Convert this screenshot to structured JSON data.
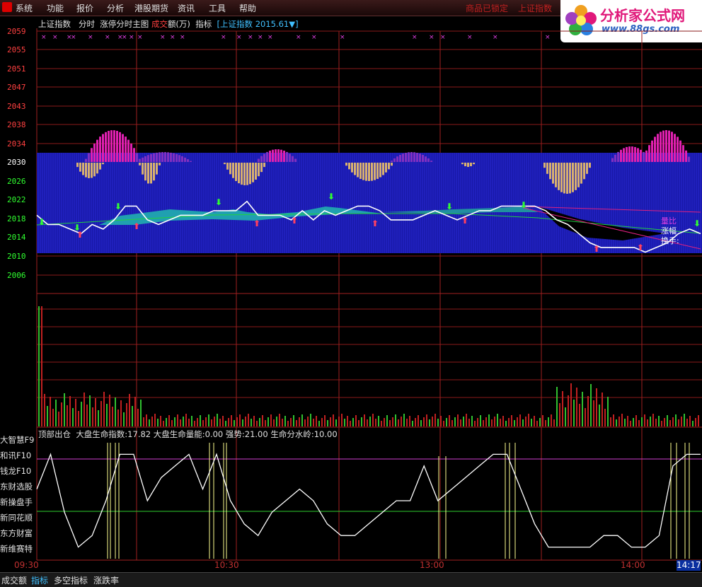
{
  "menu": {
    "items": [
      "系统",
      "功能",
      "报价",
      "分析",
      "港股期货",
      "资讯",
      "工具",
      "帮助"
    ],
    "right_items": [
      "商品已锁定",
      "上证指数"
    ]
  },
  "brand": {
    "title": "分析家公式网",
    "url": "www.88gs.com"
  },
  "header": {
    "name": "上证指数",
    "mode": "分时",
    "chart_name": "涨停分时主图",
    "volume_label_a": "成交",
    "volume_label_b": "额(万)",
    "indicator_label": "指标",
    "index_tag": "[上证指数 2015.61▼]"
  },
  "price_axis": {
    "labels": [
      "2059",
      "2055",
      "2051",
      "2047",
      "2043",
      "2038",
      "2034",
      "2030",
      "2026",
      "2022",
      "2018",
      "2014",
      "2010",
      "2006"
    ],
    "colors": {
      "up": "#ff4040",
      "flat": "#ffffff",
      "down": "#30ff30"
    }
  },
  "legend_right": {
    "a": "量比",
    "b": "涨幅",
    "c": "换手:"
  },
  "indicator": {
    "name": "顶部出仓",
    "values": "大盘生命指数:17.82  大盘生命量能:0.00  强势:21.00  生命分水岭:10.00"
  },
  "side_buttons": [
    "大智慧F9",
    "和讯F10",
    "钱龙F10",
    "东财选股",
    "新操盘手",
    "新同花顺",
    "东方财富",
    "新维赛特"
  ],
  "time_axis": {
    "labels": [
      "09:30",
      "10:30",
      "13:00",
      "14:00"
    ],
    "current": "14:17"
  },
  "tabs": [
    {
      "label": "成交额",
      "active": false
    },
    {
      "label": "指标",
      "active": true
    },
    {
      "label": "多空指标",
      "active": false
    },
    {
      "label": "涨跌率",
      "active": false
    }
  ],
  "chart_data": {
    "type": "line",
    "price_ylim": [
      2006,
      2059
    ],
    "price_x": [
      0,
      4,
      8,
      12,
      16,
      20,
      24,
      28,
      32,
      36,
      40,
      44,
      48,
      52,
      56,
      60,
      64,
      68,
      72,
      76,
      80,
      84,
      88,
      92,
      96,
      100,
      104,
      108,
      112,
      116,
      120,
      124,
      128,
      132,
      136,
      140,
      144,
      148,
      152,
      156,
      160,
      164,
      168,
      172,
      176,
      180,
      184,
      188,
      192,
      196,
      200,
      204,
      208,
      212,
      216,
      220,
      224,
      228,
      232,
      236,
      240
    ],
    "price": [
      2019,
      2017,
      2017,
      2016,
      2015,
      2017,
      2016,
      2018,
      2021,
      2021,
      2018,
      2017,
      2018,
      2019,
      2019,
      2019,
      2020,
      2020,
      2020,
      2022,
      2019,
      2019,
      2019,
      2018,
      2020,
      2018,
      2020,
      2019,
      2020,
      2021,
      2021,
      2020,
      2018,
      2018,
      2018,
      2019,
      2020,
      2019,
      2018,
      2019,
      2020,
      2020,
      2021,
      2021,
      2021,
      2021,
      2020,
      2018,
      2017,
      2015,
      2013,
      2012,
      2012,
      2012,
      2012,
      2011,
      2012,
      2013,
      2015,
      2016,
      2015
    ],
    "indicator_ylim": [
      0,
      10
    ],
    "indicator_x": [
      0,
      5,
      10,
      15,
      20,
      25,
      30,
      35,
      40,
      45,
      50,
      55,
      60,
      65,
      70,
      75,
      80,
      85,
      90,
      95,
      100,
      105,
      110,
      115,
      120,
      125,
      130,
      135,
      140,
      145,
      150,
      155,
      160,
      165,
      170,
      175,
      180,
      185,
      190,
      195,
      200,
      205,
      210,
      215,
      220,
      225,
      230,
      235,
      240
    ],
    "indicator": [
      6,
      9,
      4,
      1,
      2,
      5,
      9,
      9,
      5,
      7,
      8,
      9,
      6,
      9,
      5,
      3,
      2,
      4,
      5,
      6,
      5,
      3,
      2,
      2,
      3,
      4,
      5,
      5,
      8,
      5,
      6,
      7,
      8,
      9,
      9,
      6,
      3,
      1,
      1,
      1,
      1,
      2,
      2,
      1,
      1,
      2,
      8,
      9,
      9
    ]
  }
}
